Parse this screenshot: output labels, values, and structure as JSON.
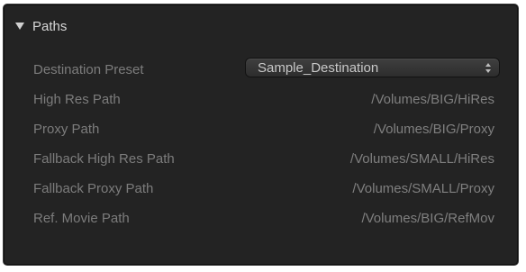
{
  "section": {
    "title": "Paths",
    "expanded": true
  },
  "fields": [
    {
      "label": "Destination Preset",
      "type": "select",
      "value": "Sample_Destination"
    },
    {
      "label": "High Res Path",
      "type": "text",
      "value": "/Volumes/BIG/HiRes"
    },
    {
      "label": "Proxy Path",
      "type": "text",
      "value": "/Volumes/BIG/Proxy"
    },
    {
      "label": "Fallback High Res Path",
      "type": "text",
      "value": "/Volumes/SMALL/HiRes"
    },
    {
      "label": "Fallback Proxy Path",
      "type": "text",
      "value": "/Volumes/SMALL/Proxy"
    },
    {
      "label": "Ref. Movie Path",
      "type": "text",
      "value": "/Volumes/BIG/RefMov"
    }
  ],
  "colors": {
    "panel_background": "#232323",
    "label": "#7c7c7c",
    "title": "#d6d6d6",
    "select_text": "#c8c8c8"
  },
  "icons": {
    "disclosure": "triangle-down-icon",
    "select_arrows": "up-down-chevron-icon"
  }
}
